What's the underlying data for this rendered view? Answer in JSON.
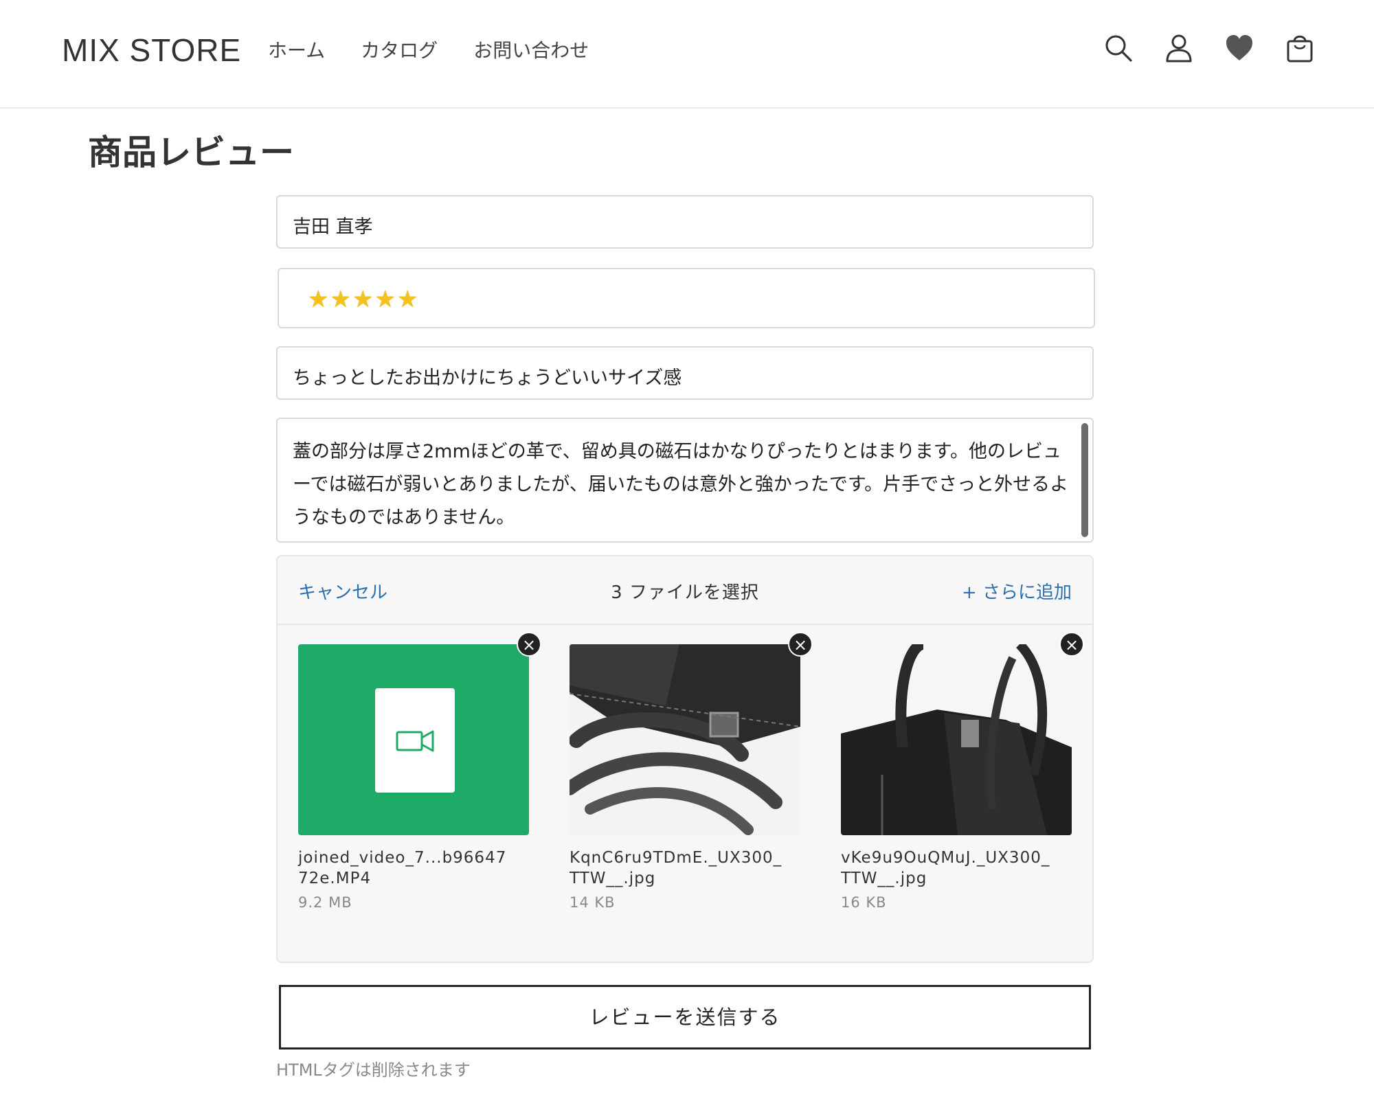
{
  "header": {
    "logo": "MIX STORE",
    "nav": [
      "ホーム",
      "カタログ",
      "お問い合わせ"
    ],
    "icons": [
      "search-icon",
      "account-icon",
      "heart-icon",
      "cart-icon"
    ]
  },
  "page": {
    "title": "商品レビュー"
  },
  "form": {
    "name_value": "吉田 直孝",
    "rating": 5,
    "stars": "★★★★★",
    "subject_value": "ちょっとしたお出かけにちょうどいいサイズ感",
    "body_value": "蓋の部分は厚さ2mmほどの革で、留め具の磁石はかなりぴったりとはまります。他のレビューでは磁石が弱いとありましたが、届いたものは意外と強かったです。片手でさっと外せるようなものではありません。"
  },
  "upload": {
    "cancel_label": "キャンセル",
    "selected_label": "3 ファイルを選択",
    "add_more_label": "+ さらに追加",
    "files": [
      {
        "name": "joined_video_7...b96647\n72e.MP4",
        "size": "9.2 MB",
        "kind": "video"
      },
      {
        "name": "KqnC6ru9TDmE._UX300_\nTTW__.jpg",
        "size": "14 KB",
        "kind": "image"
      },
      {
        "name": "vKe9u9OuQMuJ._UX300_\nTTW__.jpg",
        "size": "16 KB",
        "kind": "image"
      }
    ],
    "remove_glyph": "×"
  },
  "submit_label": "レビューを送信する",
  "note": "HTMLタグは削除されます",
  "colors": {
    "accent_link": "#2a6fb0",
    "video_tile": "#1faa68",
    "star": "#f4c21c"
  }
}
